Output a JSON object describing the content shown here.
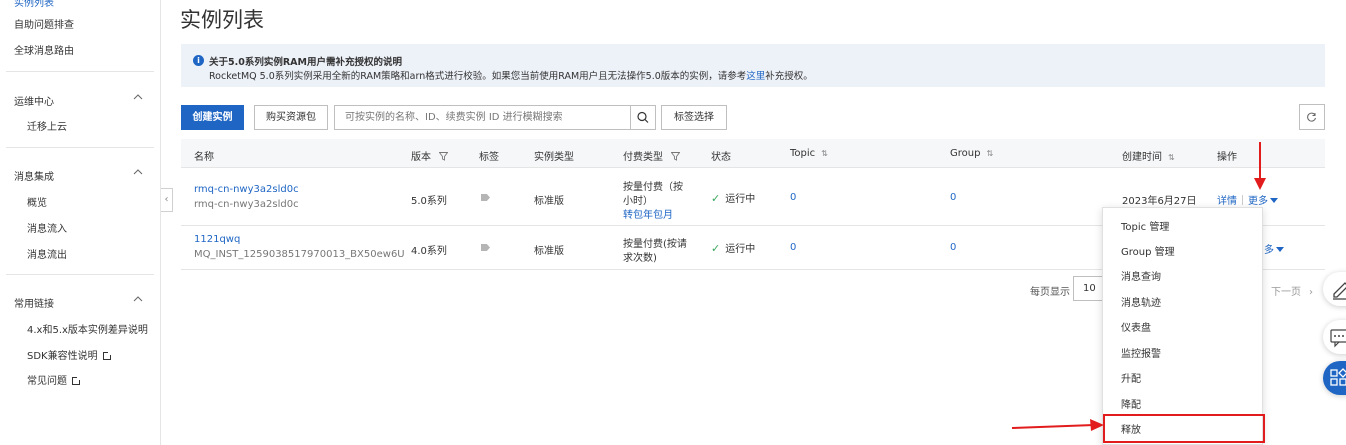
{
  "sidebar": {
    "top_cut": "实例列表",
    "items_top": [
      "自助问题排查",
      "全球消息路由"
    ],
    "groups": [
      {
        "title": "运维中心",
        "items": [
          "迁移上云"
        ]
      },
      {
        "title": "消息集成",
        "items": [
          "概览",
          "消息流入",
          "消息流出"
        ]
      },
      {
        "title": "常用链接",
        "items": [
          "4.x和5.x版本实例差异说明",
          "SDK兼容性说明",
          "常见问题"
        ]
      }
    ]
  },
  "page": {
    "title": "实例列表"
  },
  "notice": {
    "title": "关于5.0系列实例RAM用户需补充授权的说明",
    "body_pre": "RocketMQ 5.0系列实例采用全新的RAM策略和arn格式进行校验。如果您当前使用RAM用户且无法操作5.0版本的实例，请参考",
    "body_link": "这里",
    "body_post": "补充授权。"
  },
  "toolbar": {
    "create": "创建实例",
    "buy": "购买资源包",
    "search_placeholder": "可按实例的名称、ID、续费实例 ID 进行模糊搜索",
    "tag_filter": "标签选择"
  },
  "table": {
    "headers": {
      "name": "名称",
      "version": "版本",
      "tag": "标签",
      "type": "实例类型",
      "billing": "付费类型",
      "status": "状态",
      "topic": "Topic",
      "group": "Group",
      "created": "创建时间",
      "action": "操作"
    },
    "rows": [
      {
        "name": "rmq-cn-nwy3a2sld0c",
        "id": "rmq-cn-nwy3a2sld0c",
        "version": "5.0系列",
        "type": "标准版",
        "billing_l1": "按量付费（按",
        "billing_l2": "小时）",
        "billing_link": "转包年包月",
        "status": "运行中",
        "topic": "0",
        "group": "0",
        "created": "2023年6月27日",
        "detail": "详情",
        "more": "更多"
      },
      {
        "name": "1121qwq",
        "id": "MQ_INST_1259038517970013_BX50ew6U",
        "version": "4.0系列",
        "type": "标准版",
        "billing_l1": "按量付费(按请",
        "billing_l2": "求次数)",
        "status": "运行中",
        "topic": "0",
        "group": "0",
        "more_partial": "多"
      }
    ]
  },
  "pager": {
    "label": "每页显示",
    "size": "10",
    "next": "下一页"
  },
  "dropdown": [
    "Topic 管理",
    "Group 管理",
    "消息查询",
    "消息轨迹",
    "仪表盘",
    "监控报警",
    "升配",
    "降配",
    "释放"
  ],
  "colors": {
    "primary": "#1f66c4",
    "annotation_red": "#e21c1c",
    "success": "#3ba55d"
  }
}
